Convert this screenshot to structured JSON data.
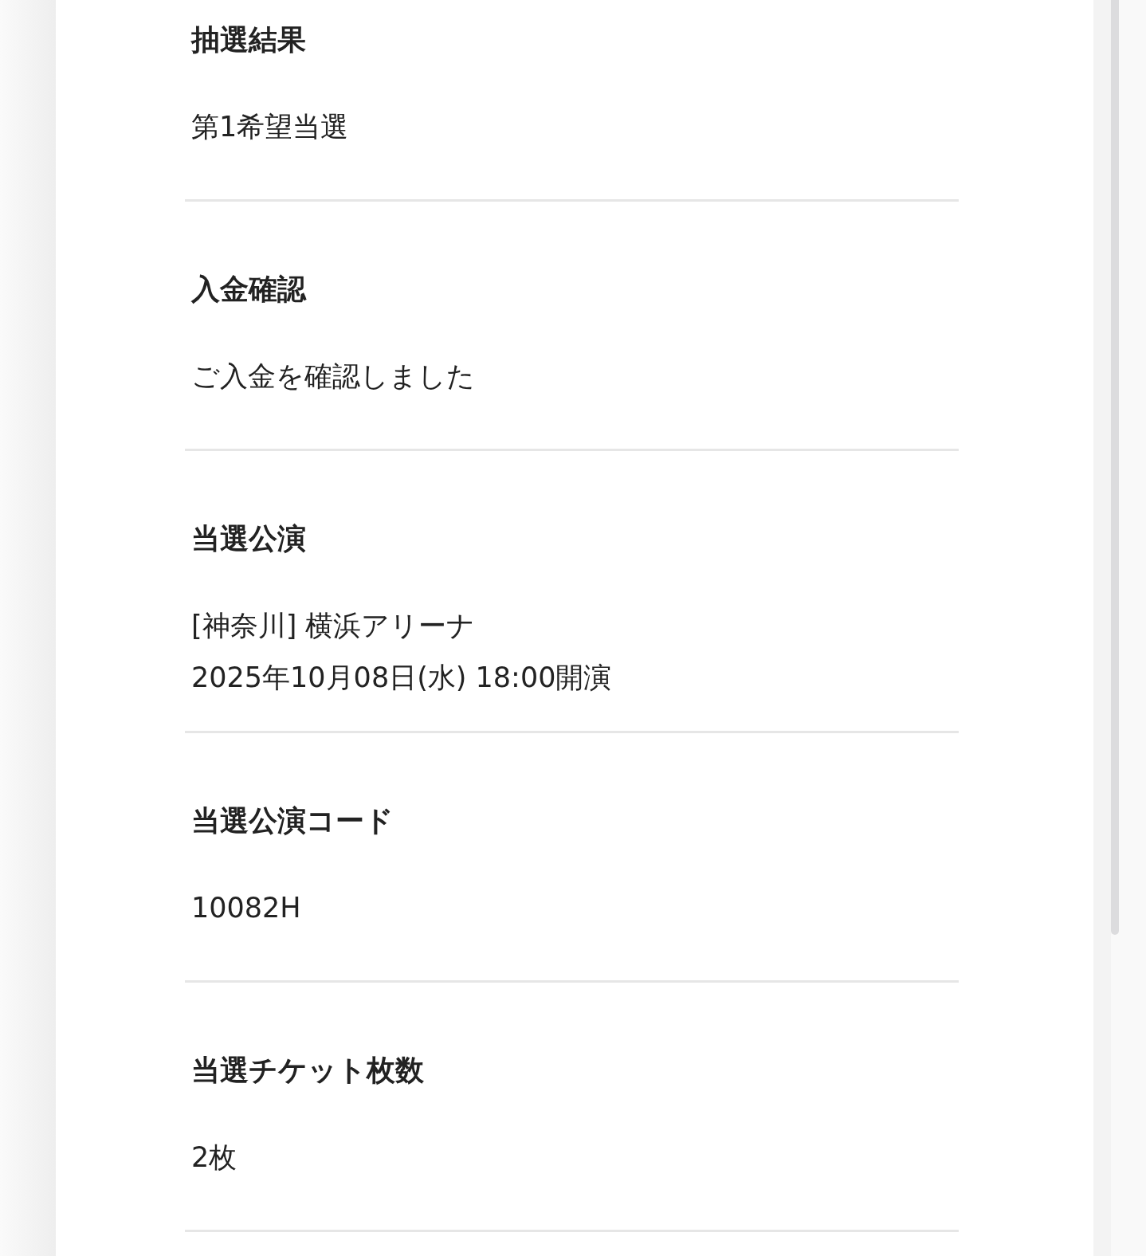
{
  "sections": [
    {
      "heading": "抽選結果",
      "lines": [
        "第1希望当選"
      ]
    },
    {
      "heading": "入金確認",
      "lines": [
        "ご入金を確認しました"
      ]
    },
    {
      "heading": "当選公演",
      "lines": [
        "[神奈川] 横浜アリーナ",
        "2025年10月08日(水) 18:00開演"
      ]
    },
    {
      "heading": "当選公演コード",
      "lines": [
        "10082H"
      ]
    },
    {
      "heading": "当選チケット枚数",
      "lines": [
        "2枚"
      ]
    }
  ]
}
